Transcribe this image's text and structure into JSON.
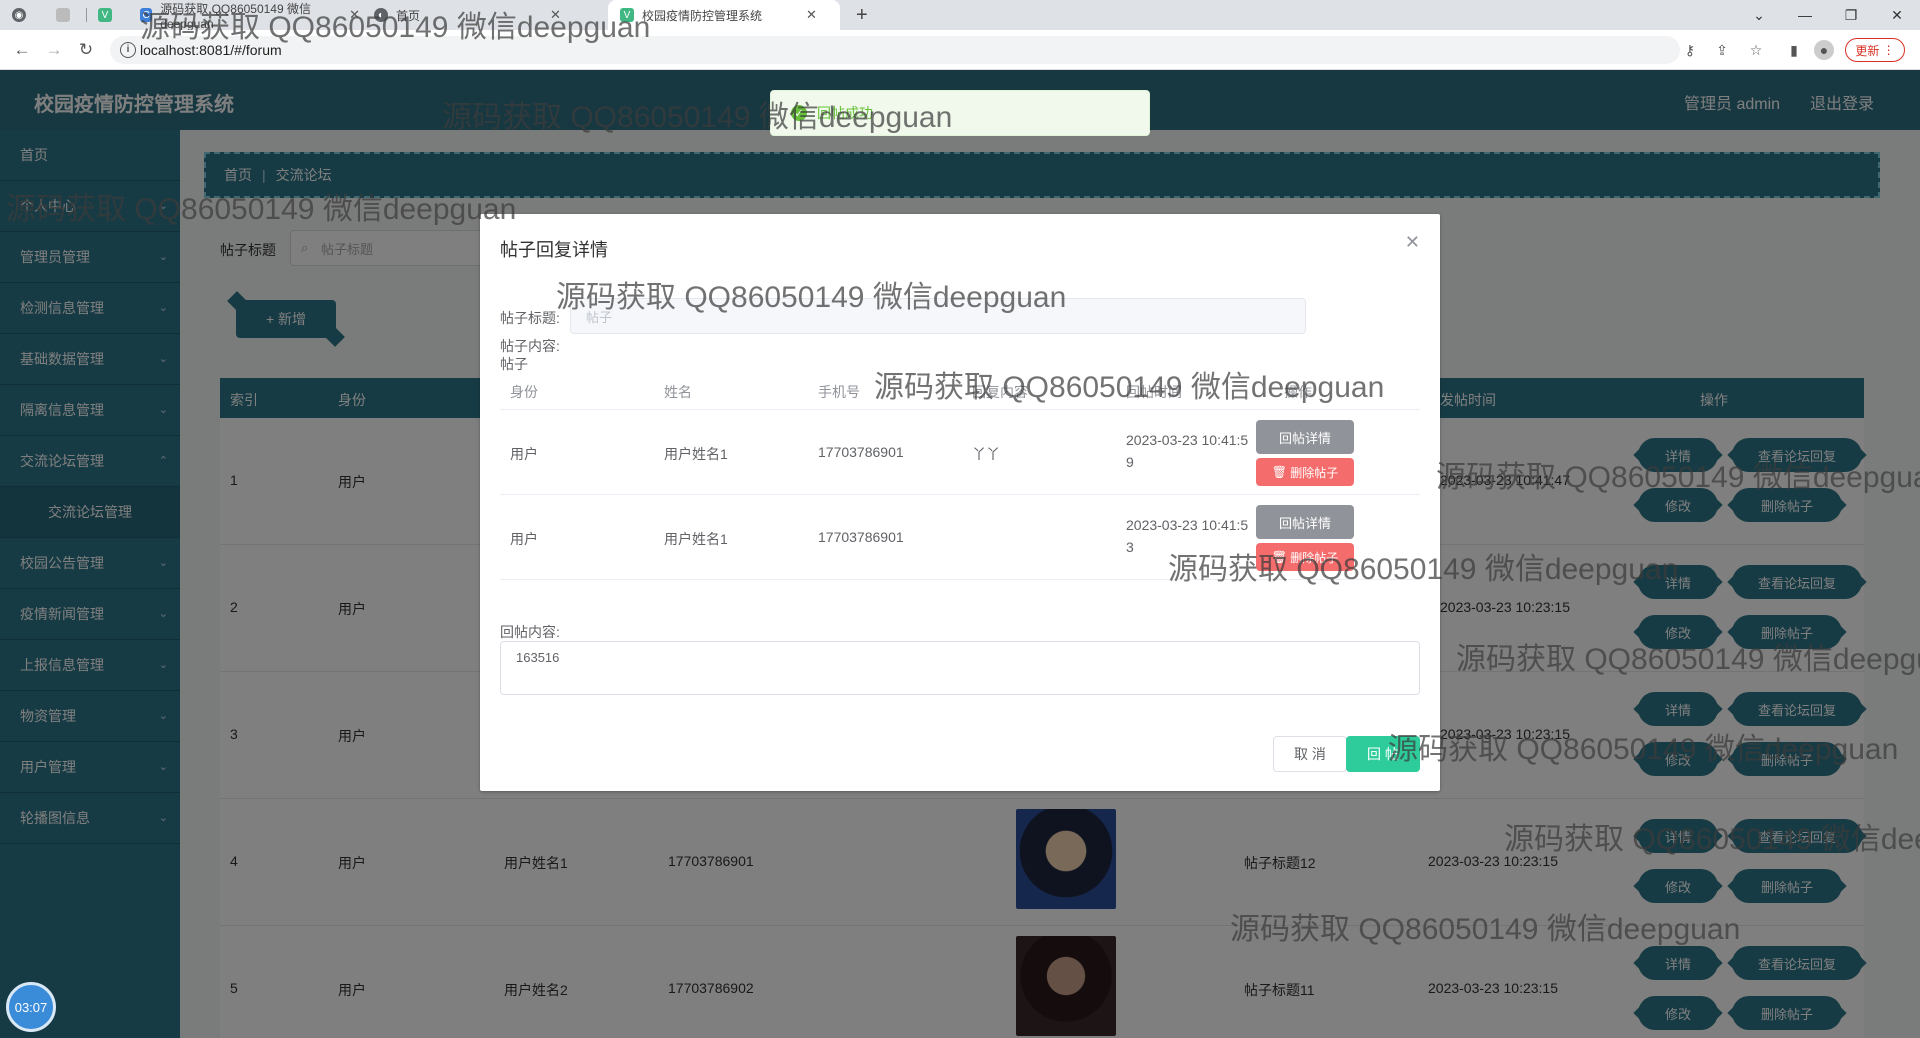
{
  "browser": {
    "tabs": [
      {
        "label": "源码获取 QQ86050149 微信deepguan"
      },
      {
        "label": "首页"
      },
      {
        "label": "校园疫情防控管理系统"
      }
    ],
    "url": "localhost:8081/#/forum",
    "update_label": "更新"
  },
  "header": {
    "title": "校园疫情防控管理系统",
    "user": "管理员 admin",
    "logout": "退出登录"
  },
  "sidebar": {
    "items": [
      {
        "label": "首页"
      },
      {
        "label": "个人中心"
      },
      {
        "label": "管理员管理"
      },
      {
        "label": "检测信息管理"
      },
      {
        "label": "基础数据管理"
      },
      {
        "label": "隔离信息管理"
      },
      {
        "label": "交流论坛管理"
      },
      {
        "label": "交流论坛管理"
      },
      {
        "label": "校园公告管理"
      },
      {
        "label": "疫情新闻管理"
      },
      {
        "label": "上报信息管理"
      },
      {
        "label": "物资管理"
      },
      {
        "label": "用户管理"
      },
      {
        "label": "轮播图信息"
      }
    ],
    "timer": "03:07"
  },
  "breadcrumb": {
    "home": "首页",
    "current": "交流论坛"
  },
  "search": {
    "label": "帖子标题",
    "placeholder": "帖子标题"
  },
  "add_label": "+ 新增",
  "table": {
    "headers": {
      "index": "索引",
      "identity": "身份",
      "time": "发帖时间",
      "ops": "操作"
    },
    "rows": [
      {
        "index": "1",
        "identity": "用户",
        "name": "",
        "phone": "",
        "title": "",
        "time": "2023-03-23 10:41:47"
      },
      {
        "index": "2",
        "identity": "用户",
        "name": "",
        "phone": "",
        "title": "",
        "time": "2023-03-23 10:23:15"
      },
      {
        "index": "3",
        "identity": "用户",
        "name": "",
        "phone": "",
        "title": "",
        "time": "2023-03-23 10:23:15"
      },
      {
        "index": "4",
        "identity": "用户",
        "name": "用户姓名1",
        "phone": "17703786901",
        "title": "帖子标题12",
        "time": "2023-03-23 10:23:15"
      },
      {
        "index": "5",
        "identity": "用户",
        "name": "用户姓名2",
        "phone": "17703786902",
        "title": "帖子标题11",
        "time": "2023-03-23 10:23:15"
      }
    ],
    "btn_detail": "详情",
    "btn_view_reply": "查看论坛回复",
    "btn_edit": "修改",
    "btn_delete": "删除帖子"
  },
  "toast": {
    "text": "回帖成功"
  },
  "dialog": {
    "title": "帖子回复详情",
    "post_title_label": "帖子标题:",
    "post_title_value": "帖子",
    "post_content_label": "帖子内容:",
    "post_content_value": "帖子",
    "headers": {
      "identity": "身份",
      "name": "姓名",
      "phone": "手机号",
      "content": "回复内容",
      "time": "回帖时间",
      "ops": "操作"
    },
    "rows": [
      {
        "identity": "用户",
        "name": "用户姓名1",
        "phone": "17703786901",
        "content": "丫丫",
        "time_line1": "2023-03-23 10:41:5",
        "time_line2": "9"
      },
      {
        "identity": "用户",
        "name": "用户姓名1",
        "phone": "17703786901",
        "content": "",
        "time_line1": "2023-03-23 10:41:5",
        "time_line2": "3"
      }
    ],
    "btn_reply_detail": "回帖详情",
    "btn_delete_post": "删除帖子",
    "reply_label": "回帖内容:",
    "reply_value": "163516",
    "cancel": "取 消",
    "submit": "回 帖"
  },
  "watermark": "源码获取 QQ86050149 微信deepguan"
}
